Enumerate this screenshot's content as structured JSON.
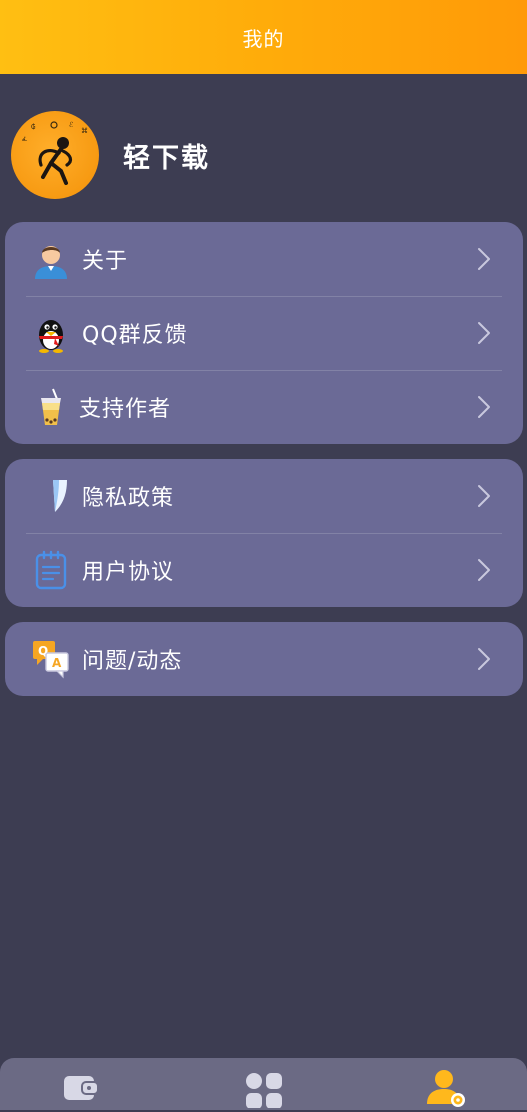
{
  "header": {
    "title": "我的"
  },
  "profile": {
    "app_name": "轻下载",
    "avatar": "stickman-logo"
  },
  "groups": [
    {
      "items": [
        {
          "label": "关于",
          "icon": "person-avatar-icon"
        },
        {
          "label": "QQ群反馈",
          "icon": "qq-penguin-icon"
        },
        {
          "label": "支持作者",
          "icon": "bubble-tea-icon"
        }
      ]
    },
    {
      "items": [
        {
          "label": "隐私政策",
          "icon": "shield-icon"
        },
        {
          "label": "用户协议",
          "icon": "notepad-icon"
        }
      ]
    },
    {
      "items": [
        {
          "label": "问题/动态",
          "icon": "qa-icon"
        }
      ]
    }
  ],
  "bottom_nav": [
    {
      "name": "wallet",
      "icon": "wallet-icon",
      "active": false
    },
    {
      "name": "apps",
      "icon": "grid-icon",
      "active": false
    },
    {
      "name": "mine",
      "icon": "user-settings-icon",
      "active": true
    }
  ],
  "colors": {
    "header_gradient_start": "#ffbf12",
    "header_gradient_end": "#ff9a08",
    "background": "#3d3d52",
    "card": "#6b6a96",
    "nav_active": "#ffb81c",
    "nav_inactive": "#d8d8e6"
  }
}
